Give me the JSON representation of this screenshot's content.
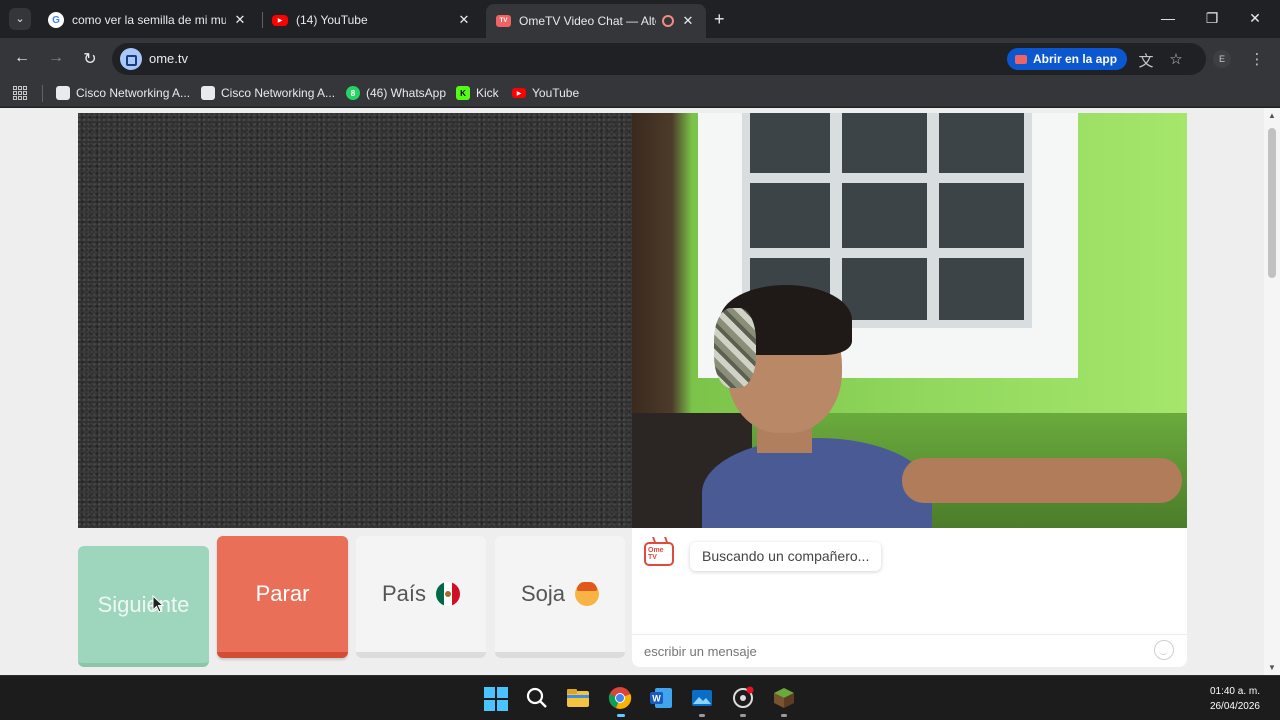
{
  "browser": {
    "tabs": [
      {
        "title": "como ver la semilla de mi mundo",
        "active": false
      },
      {
        "title": "(14) YouTube",
        "active": false
      },
      {
        "title": "OmeTV Video Chat — Alternative",
        "active": true
      }
    ],
    "url": "ome.tv",
    "open_in_app_label": "Abrir en la app",
    "profile_initial": "E",
    "bookmarks": [
      {
        "label": "Cisco Networking A..."
      },
      {
        "label": "Cisco Networking A..."
      },
      {
        "label": "(46) WhatsApp",
        "badge": "8"
      },
      {
        "label": "Kick"
      },
      {
        "label": "YouTube"
      }
    ]
  },
  "page": {
    "buttons": {
      "next_label": "Siguiente",
      "stop_label": "Parar",
      "country_label": "País",
      "gender_label": "Soja"
    },
    "chat": {
      "logo_text": "Ome TV",
      "status_message": "Buscando un compañero...",
      "input_placeholder": "escribir un mensaje"
    }
  },
  "taskbar": {
    "time": "01:40 a. m.",
    "date": "26/04/2026"
  },
  "colors": {
    "next_button": "#9dd6bd",
    "stop_button": "#ea6f58",
    "open_app_button": "#0b57d0"
  }
}
